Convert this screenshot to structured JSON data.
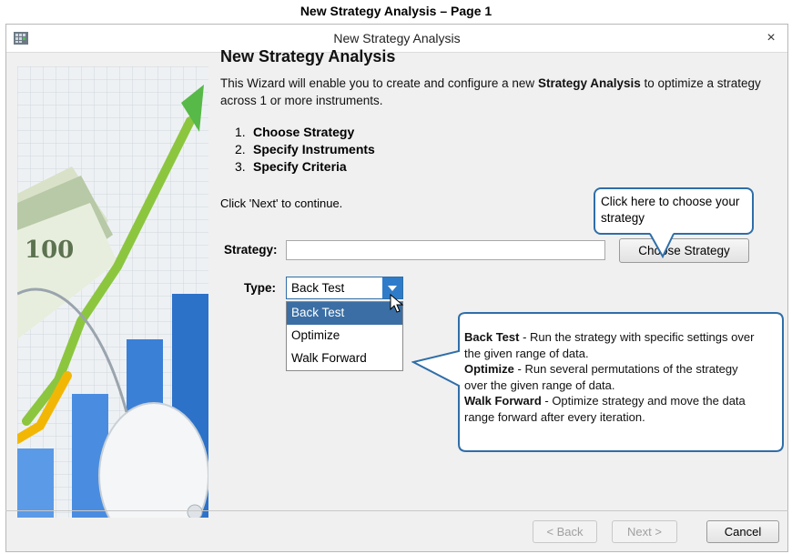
{
  "caption": "New Strategy Analysis – Page 1",
  "window": {
    "title": "New Strategy Analysis",
    "close_glyph": "×"
  },
  "content": {
    "heading": "New Strategy Analysis",
    "intro_pre": "This Wizard will enable you to create and configure a new ",
    "intro_bold": "Strategy Analysis",
    "intro_post": " to optimize a strategy across 1 or more instruments.",
    "steps": [
      {
        "num": "1.",
        "label": "Choose Strategy"
      },
      {
        "num": "2.",
        "label": "Specify Instruments"
      },
      {
        "num": "3.",
        "label": "Specify Criteria"
      }
    ],
    "continue_text": "Click 'Next' to continue."
  },
  "form": {
    "strategy_label": "Strategy:",
    "strategy_value": "",
    "choose_button": "Choose Strategy",
    "type_label": "Type:",
    "type_value": "Back Test",
    "type_options": [
      "Back Test",
      "Optimize",
      "Walk Forward"
    ],
    "type_selected_index": 0
  },
  "callouts": {
    "choose": "Click here to choose your strategy",
    "types": [
      {
        "term": "Back Test",
        "desc": " - Run the strategy with specific settings over the given range of data."
      },
      {
        "term": "Optimize",
        "desc": " - Run several permutations of the strategy over the given range of data."
      },
      {
        "term": "Walk Forward",
        "desc": " -  Optimize strategy and move the data range forward after every iteration."
      }
    ]
  },
  "buttons": {
    "back": "< Back",
    "next": "Next >",
    "cancel": "Cancel"
  },
  "colors": {
    "accent": "#2e7cc9",
    "selection": "#3a6ea5",
    "callout_border": "#2f6ea8"
  }
}
